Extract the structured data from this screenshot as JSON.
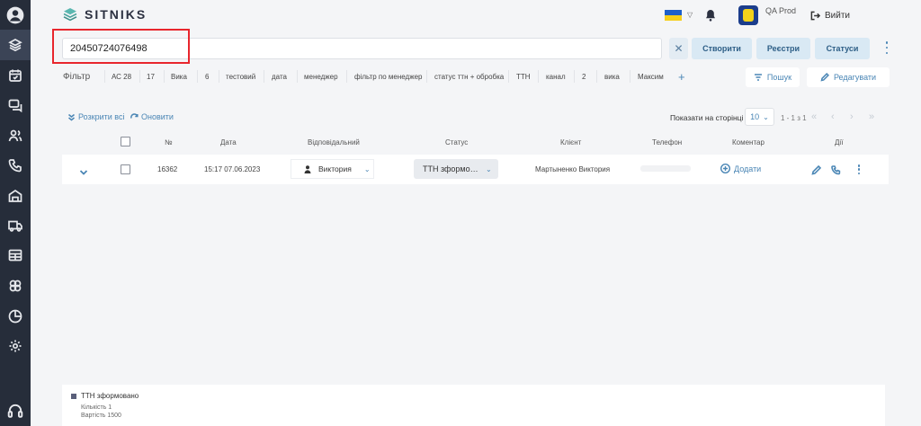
{
  "header": {
    "logo_text": "SITNIKS",
    "user_name": "QA Prod",
    "logout_label": "Вийти"
  },
  "search": {
    "value": "20450724076498",
    "clear_label": "✕"
  },
  "actions": {
    "create": "Створити",
    "registries": "Реєстри",
    "statuses": "Статуси"
  },
  "filters": {
    "label": "Фільтр",
    "chips": [
      "АС 28",
      "17",
      "Вика",
      "6",
      "тестовий",
      "дата",
      "менеджер",
      "фільтр по менеджер",
      "статус ттн + обробка",
      "ТТН",
      "канал",
      "2",
      "вика",
      "Максим"
    ],
    "add": "+",
    "search_btn": "Пошук",
    "edit_btn": "Редагувати"
  },
  "toolbar": {
    "expand_all": "Розкрити всі",
    "refresh": "Оновити",
    "per_page_label": "Показати на сторінці",
    "per_page_value": "10",
    "range": "1 - 1 з 1"
  },
  "table": {
    "headers": [
      "№",
      "Дата",
      "Відповідальний",
      "Статус",
      "Клієнт",
      "Телефон",
      "Коментар",
      "Дії"
    ],
    "rows": [
      {
        "number": "16362",
        "date": "15:17 07.06.2023",
        "responsible": "Виктория",
        "status": "ТТН зформовано",
        "client": "Мартыненко Виктория",
        "comment_add": "Додати"
      }
    ]
  },
  "summary": {
    "status": "ТТН зформовано",
    "count_line": "Кількість 1",
    "value_line": "Вартість 1500"
  },
  "colors": {
    "sidebar": "#262d3a",
    "accent": "#4a86b5",
    "highlight": "#e8262d",
    "flag_blue": "#1d5fc9",
    "flag_yellow": "#f6cf1a"
  },
  "icons": {
    "sidebar": [
      "user-avatar-icon",
      "layers-icon",
      "calendar-icon",
      "chat-icon",
      "users-icon",
      "phone-icon",
      "warehouse-icon",
      "truck-icon",
      "table-icon",
      "circles-icon",
      "chart-pie-icon",
      "settings-icon",
      "headset-icon"
    ]
  }
}
